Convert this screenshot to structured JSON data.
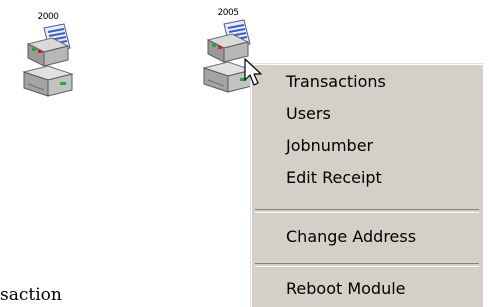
{
  "devices": [
    {
      "year": "2000",
      "icon": "printer-fax-icon"
    },
    {
      "year": "2005",
      "icon": "printer-fax-icon"
    }
  ],
  "context_menu": {
    "items": [
      {
        "label": "Transactions"
      },
      {
        "label": "Users"
      },
      {
        "label": "Jobnumber"
      },
      {
        "label": "Edit Receipt"
      },
      {
        "label": "Change Address"
      },
      {
        "label": "Reboot Module"
      }
    ]
  },
  "background_text": "saction",
  "colors": {
    "menu_bg": "#d4d0c8",
    "device_body": "#c8c8c8",
    "paper_blue": "#3b5bc9",
    "led_green": "#1faa3a"
  }
}
